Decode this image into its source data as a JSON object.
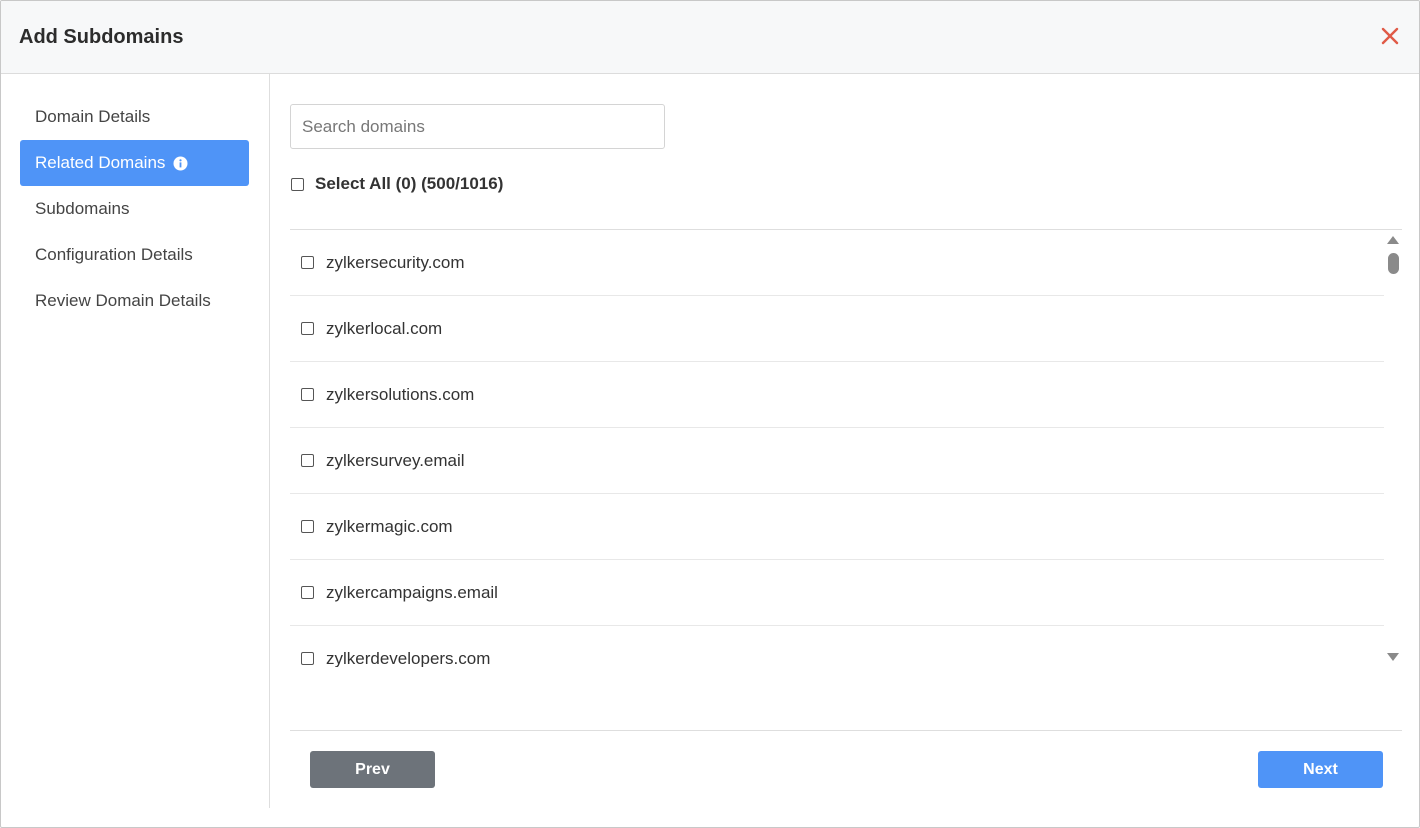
{
  "dialog": {
    "title": "Add Subdomains",
    "close_icon": "close-icon"
  },
  "sidebar": {
    "items": [
      {
        "label": "Domain Details",
        "active": false
      },
      {
        "label": "Related Domains",
        "active": true,
        "icon": "info-icon"
      },
      {
        "label": "Subdomains",
        "active": false
      },
      {
        "label": "Configuration Details",
        "active": false
      },
      {
        "label": "Review Domain Details",
        "active": false
      }
    ]
  },
  "search": {
    "placeholder": "Search domains",
    "value": ""
  },
  "select_all": {
    "label": "Select All (0) (500/1016)",
    "checked": false
  },
  "domains": [
    {
      "name": "zylkersecurity.com",
      "checked": false
    },
    {
      "name": "zylkerlocal.com",
      "checked": false
    },
    {
      "name": "zylkersolutions.com",
      "checked": false
    },
    {
      "name": "zylkersurvey.email",
      "checked": false
    },
    {
      "name": "zylkermagic.com",
      "checked": false
    },
    {
      "name": "zylkercampaigns.email",
      "checked": false
    },
    {
      "name": "zylkerdevelopers.com",
      "checked": false
    }
  ],
  "footer": {
    "prev_label": "Prev",
    "next_label": "Next"
  },
  "colors": {
    "accent": "#4f94f7",
    "secondary_button": "#6d737a",
    "close": "#e05a47"
  }
}
